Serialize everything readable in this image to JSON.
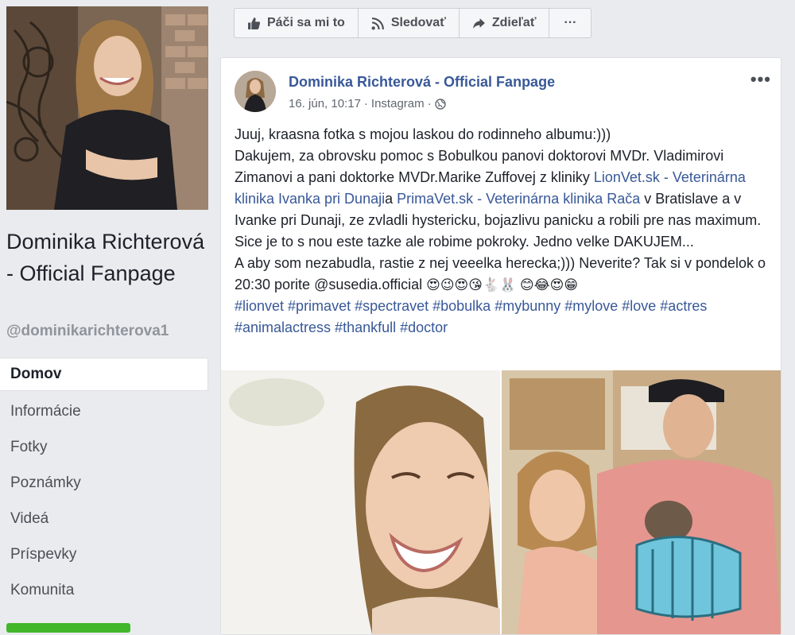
{
  "page": {
    "name": "Dominika Richterová - Official Fanpage",
    "handle": "@dominikarichterova1"
  },
  "nav": [
    {
      "label": "Domov",
      "active": true
    },
    {
      "label": "Informácie"
    },
    {
      "label": "Fotky"
    },
    {
      "label": "Poznámky"
    },
    {
      "label": "Videá"
    },
    {
      "label": "Príspevky"
    },
    {
      "label": "Komunita"
    }
  ],
  "actions": {
    "like": "Páči sa mi to",
    "follow": "Sledovať",
    "share": "Zdieľať",
    "more": "···"
  },
  "post": {
    "author": "Dominika Richterová - Official Fanpage",
    "date": "16. jún, 10:17",
    "source": "Instagram",
    "separator": "·",
    "more": "•••",
    "p1": "Juuj, kraasna fotka s mojou laskou do rodinneho albumu:)))",
    "p2a": "Dakujem, za obrovsku pomoc s Bobulkou panovi doktorovi MVDr. Vladimirovi Zimanovi a pani doktorke MVDr.Marike Zuffovej z kliniky ",
    "link1": "LionVet.sk - Veterinárna klinika Ivanka pri Dunaji",
    "p2b": "a ",
    "link2": "PrimaVet.sk - Veterinárna klinika Rača",
    "p2c": " v Bratislave a v Ivanke pri Dunaji, ze zvladli hystericku, bojazlivu panicku a robili pre nas maximum. Sice je to s nou este tazke ale robime pokroky. Jedno velke DAKUJEM...",
    "p3": "A aby som nezabudla, rastie z nej veeelka herecka;))) Neverite? Tak si v pondelok o 20:30 porite @susedia.official ",
    "emojis": "😍😉😍😘🐇🐰 😊😂😍😁",
    "hashtags": "#lionvet #primavet #spectravet #bobulka #mybunny #mylove #love #actres #animalactress #thankfull #doctor"
  },
  "colors": {
    "link": "#385898",
    "background": "#e9ebee",
    "accent_green": "#42b72a"
  }
}
